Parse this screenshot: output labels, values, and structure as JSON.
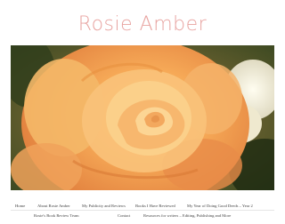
{
  "site": {
    "title": "Rosie Amber"
  },
  "header_image": {
    "alt": ""
  },
  "nav": {
    "row1": [
      {
        "label": "Home"
      },
      {
        "label": "About Rosie Amber"
      },
      {
        "label": "My Publicity and Reviews"
      },
      {
        "label": "Books I Have Reviewed"
      },
      {
        "label": "My Year of Doing Good Deeds – Year 2"
      }
    ],
    "row2": [
      {
        "label": "Rosie's Book Review Team"
      },
      {
        "label": "Contact"
      },
      {
        "label": "Resources for writers – Editing, Publishing and More"
      }
    ]
  },
  "colors": {
    "title": "#e8a3a0",
    "nav_text": "#444444"
  }
}
